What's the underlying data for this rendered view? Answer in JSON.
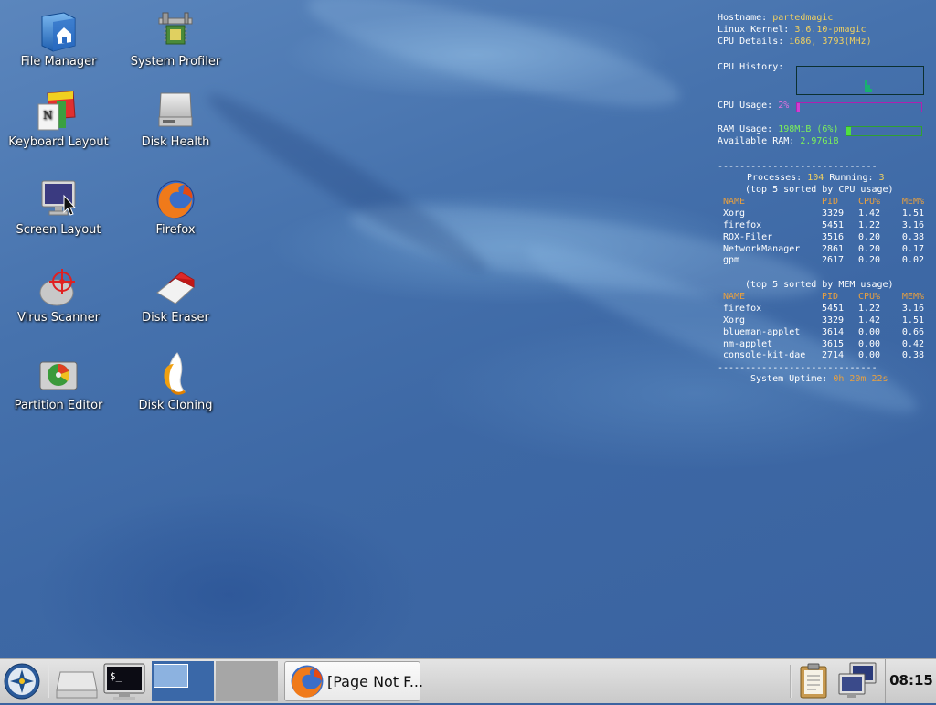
{
  "desktop_icons": [
    {
      "name": "file-manager",
      "label": "File Manager",
      "icon": "house-folder-icon"
    },
    {
      "name": "system-profiler",
      "label": "System Profiler",
      "icon": "caliper-chip-icon"
    },
    {
      "name": "keyboard-layout",
      "label": "Keyboard Layout",
      "icon": "keyboard-flag-icon"
    },
    {
      "name": "disk-health",
      "label": "Disk Health",
      "icon": "hard-disk-icon"
    },
    {
      "name": "screen-layout",
      "label": "Screen Layout",
      "icon": "monitor-icon"
    },
    {
      "name": "firefox",
      "label": "Firefox",
      "icon": "firefox-icon"
    },
    {
      "name": "virus-scanner",
      "label": "Virus Scanner",
      "icon": "crosshair-icon"
    },
    {
      "name": "disk-eraser",
      "label": "Disk Eraser",
      "icon": "eraser-icon"
    },
    {
      "name": "partition-editor",
      "label": "Partition Editor",
      "icon": "partition-disk-icon"
    },
    {
      "name": "disk-cloning",
      "label": "Disk Cloning",
      "icon": "penguin-clone-icon"
    }
  ],
  "conky": {
    "hostname_label": "Hostname:",
    "hostname": "partedmagic",
    "kernel_label": "Linux Kernel:",
    "kernel": "3.6.10-pmagic",
    "cpu_details_label": "CPU Details:",
    "cpu_details": "i686, 3793(MHz)",
    "cpu_history_label": "CPU History:",
    "cpu_usage_label": "CPU Usage:",
    "cpu_usage": "2%",
    "cpu_usage_fraction": 0.02,
    "ram_usage_label": "RAM Usage:",
    "ram_usage": "198MiB (6%)",
    "ram_usage_fraction": 0.06,
    "available_ram_label": "Available RAM:",
    "available_ram": "2.97GiB",
    "divider": "-----------------------------",
    "processes_label": "Processes:",
    "processes": "104",
    "running_label": "Running:",
    "running": "3",
    "top_cpu_title": "(top 5 sorted by CPU usage)",
    "top_mem_title": "(top 5 sorted by MEM usage)",
    "headers": [
      "NAME",
      "PID",
      "CPU%",
      "MEM%"
    ],
    "top_cpu": [
      [
        "Xorg",
        "3329",
        "1.42",
        "1.51"
      ],
      [
        "firefox",
        "5451",
        "1.22",
        "3.16"
      ],
      [
        "ROX-Filer",
        "3516",
        "0.20",
        "0.38"
      ],
      [
        "NetworkManager",
        "2861",
        "0.20",
        "0.17"
      ],
      [
        "gpm",
        "2617",
        "0.20",
        "0.02"
      ]
    ],
    "top_mem": [
      [
        "firefox",
        "5451",
        "1.22",
        "3.16"
      ],
      [
        "Xorg",
        "3329",
        "1.42",
        "1.51"
      ],
      [
        "blueman-applet",
        "3614",
        "0.00",
        "0.66"
      ],
      [
        "nm-applet",
        "3615",
        "0.00",
        "0.42"
      ],
      [
        "console-kit-dae",
        "2714",
        "0.00",
        "0.38"
      ]
    ],
    "uptime_label": "System Uptime:",
    "uptime": "0h 20m 22s"
  },
  "taskbar": {
    "task_firefox_label": "[Page Not F...",
    "clock": "08:15"
  },
  "colors": {
    "desktop": "#4672ad",
    "conky_value": "#f0d060",
    "conky_green": "#7cf05a",
    "conky_magenta": "#e070e0",
    "conky_header": "#e8a040",
    "taskbar": "#d6d6d6"
  }
}
